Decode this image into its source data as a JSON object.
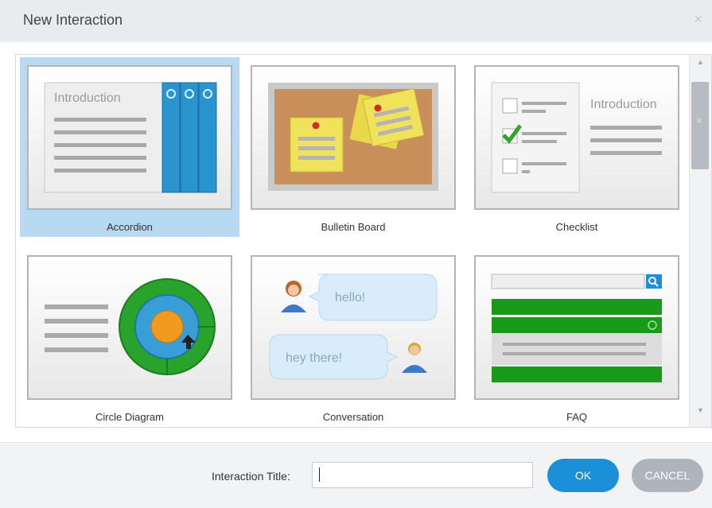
{
  "dialog": {
    "title": "New Interaction",
    "close_glyph": "×"
  },
  "gallery": {
    "items": [
      {
        "label": "Accordion",
        "selected": true,
        "thumb_text": "Introduction"
      },
      {
        "label": "Bulletin Board",
        "selected": false
      },
      {
        "label": "Checklist",
        "selected": false,
        "thumb_text": "Introduction"
      },
      {
        "label": "Circle Diagram",
        "selected": false
      },
      {
        "label": "Conversation",
        "selected": false,
        "bubble_1": "hello!",
        "bubble_2": "hey there!"
      },
      {
        "label": "FAQ",
        "selected": false
      }
    ]
  },
  "footer": {
    "field_label": "Interaction Title:",
    "title_value": "",
    "ok_label": "OK",
    "cancel_label": "CANCEL"
  },
  "colors": {
    "selection": "#b7d9f2",
    "accent_blue": "#1c8fd9",
    "cancel_gray": "#aeb5ba",
    "faq_green": "#1a9a1a"
  }
}
